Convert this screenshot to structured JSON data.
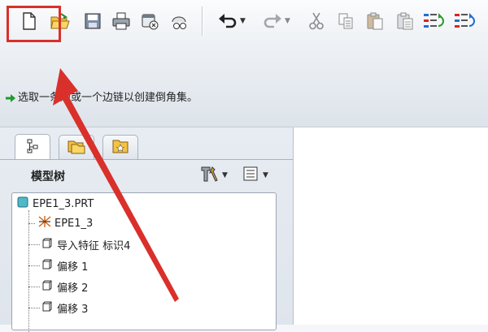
{
  "toolbar": {
    "items": [
      {
        "name": "new-file",
        "icon": "new-file-icon"
      },
      {
        "name": "open-folder",
        "icon": "open-folder-icon"
      },
      {
        "name": "save",
        "icon": "save-icon"
      },
      {
        "name": "print",
        "icon": "print-icon"
      },
      {
        "name": "close-window",
        "icon": "close-window-icon"
      },
      {
        "name": "regenerate",
        "icon": "regenerate-icon"
      },
      {
        "name": "undo",
        "icon": "undo-icon"
      },
      {
        "name": "redo",
        "icon": "redo-icon"
      },
      {
        "name": "cut",
        "icon": "cut-icon"
      },
      {
        "name": "copy",
        "icon": "copy-icon"
      },
      {
        "name": "paste",
        "icon": "paste-icon"
      },
      {
        "name": "paste-special",
        "icon": "paste-special-icon"
      },
      {
        "name": "regenerate-model",
        "icon": "regen-model-icon"
      },
      {
        "name": "regen-manager",
        "icon": "regen-manager-icon"
      }
    ],
    "highlight_color": "#d9302b"
  },
  "message": {
    "text": "选取一条边或一个边链以创建倒角集。",
    "icon": "green-arrow-icon"
  },
  "navigator": {
    "tabs": [
      {
        "name": "model-tree",
        "icon": "model-tree-icon"
      },
      {
        "name": "folder-browser",
        "icon": "folder-browser-icon"
      },
      {
        "name": "favorites",
        "icon": "favorites-icon"
      }
    ],
    "title": "模型树",
    "tree": [
      {
        "label": "EPE1_3.PRT",
        "icon": "part-icon"
      },
      {
        "label": "EPE1_3",
        "icon": "coordinate-system-icon"
      },
      {
        "label": "导入特征 标识4",
        "icon": "feature-icon"
      },
      {
        "label": "偏移 1",
        "icon": "feature-icon"
      },
      {
        "label": "偏移 2",
        "icon": "feature-icon"
      },
      {
        "label": "偏移 3",
        "icon": "feature-icon"
      }
    ]
  },
  "annotation": {
    "color": "#d9302b"
  }
}
